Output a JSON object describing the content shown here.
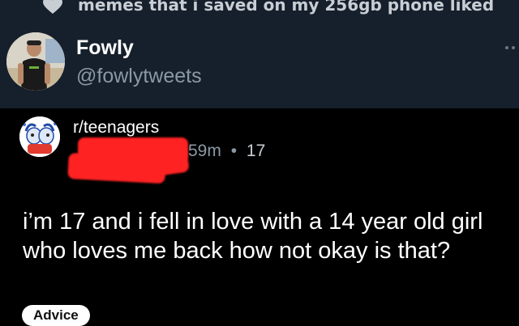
{
  "liked_banner": {
    "text": "memes that i saved on my 256gb phone liked",
    "icon": "heart-icon"
  },
  "tweet_author": {
    "display_name": "Fowly",
    "handle": "@fowlytweets"
  },
  "reddit_post": {
    "subreddit": "r/teenagers",
    "age": "59m",
    "separator": "•",
    "count": "17",
    "title": "i’m 17 and i fell in love with a 14 year old girl who loves me back how not okay is that?",
    "flair": "Advice"
  },
  "colors": {
    "tweet_bg": "#16202c",
    "post_bg": "#000000",
    "redaction": "#ff2222",
    "muted_text": "#8b98a5"
  }
}
